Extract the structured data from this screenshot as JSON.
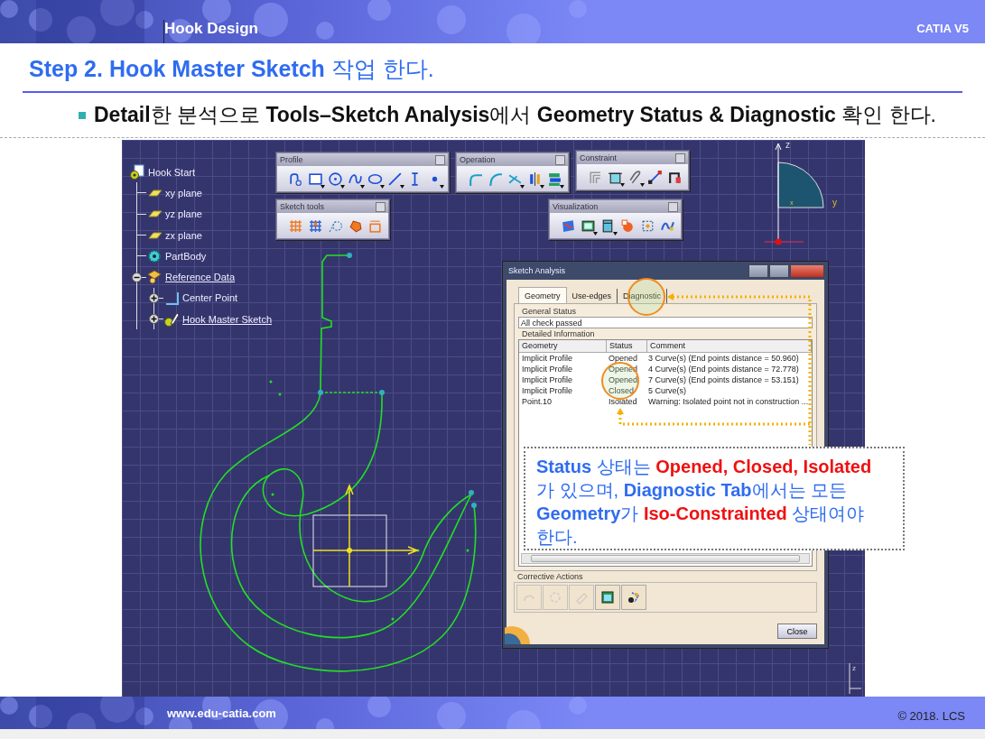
{
  "header": {
    "title": "Hook Design",
    "product": "CATIA V5"
  },
  "heading": "**Step 2. Hook Master Sketch** 작업 한다.",
  "bullet": "**Detail**한 분석으로 **Tools–Sketch Analysis**에서 **Geometry Status & Diagnostic** 확인 한다.",
  "tree": [
    {
      "label": "Hook Start",
      "kind": "part",
      "underlined": false,
      "children": [
        {
          "label": "xy plane",
          "kind": "plane",
          "underlined": false
        },
        {
          "label": "yz plane",
          "kind": "plane",
          "underlined": false
        },
        {
          "label": "zx plane",
          "kind": "plane",
          "underlined": false
        },
        {
          "label": "PartBody",
          "kind": "body",
          "underlined": false
        },
        {
          "label": "Reference Data",
          "kind": "geoset",
          "expanded": true,
          "underlined": true,
          "children": [
            {
              "label": "Center Point",
              "kind": "point",
              "expanded": false,
              "underlined": false
            },
            {
              "label": "Hook Master Sketch",
              "kind": "sketch",
              "expanded": false,
              "underlined": true
            }
          ]
        }
      ]
    }
  ],
  "toolbars": [
    {
      "title": "Profile",
      "tools": [
        {
          "kind": "profile",
          "dropdown": false
        },
        {
          "kind": "rectangle",
          "dropdown": true
        },
        {
          "kind": "circle",
          "dropdown": true
        },
        {
          "kind": "spline",
          "dropdown": true
        },
        {
          "kind": "ellipse",
          "dropdown": true
        },
        {
          "kind": "line",
          "dropdown": true
        },
        {
          "kind": "axis",
          "dropdown": false
        },
        {
          "kind": "point",
          "dropdown": true
        }
      ]
    },
    {
      "title": "Operation",
      "tools": [
        {
          "kind": "corner",
          "dropdown": false
        },
        {
          "kind": "chamfer",
          "dropdown": false
        },
        {
          "kind": "trim",
          "dropdown": true
        },
        {
          "kind": "mirror",
          "dropdown": true
        },
        {
          "kind": "project",
          "dropdown": true
        }
      ]
    },
    {
      "title": "Constraint",
      "tools": [
        {
          "kind": "bracket",
          "dropdown": false
        },
        {
          "kind": "box",
          "dropdown": true
        },
        {
          "kind": "clip",
          "dropdown": true
        },
        {
          "kind": "diagonal",
          "dropdown": false
        },
        {
          "kind": "animate",
          "dropdown": false
        }
      ]
    },
    {
      "title": "Sketch tools",
      "tools": [
        {
          "kind": "grid",
          "dropdown": false
        },
        {
          "kind": "snap",
          "dropdown": false
        },
        {
          "kind": "construction",
          "dropdown": false
        },
        {
          "kind": "hand",
          "dropdown": false
        },
        {
          "kind": "dimension",
          "dropdown": false
        }
      ]
    },
    {
      "title": "Visualization",
      "tools": [
        {
          "kind": "cut",
          "dropdown": false
        },
        {
          "kind": "frame",
          "dropdown": true
        },
        {
          "kind": "solid",
          "dropdown": true
        },
        {
          "kind": "sun",
          "dropdown": false
        },
        {
          "kind": "dots",
          "dropdown": false
        },
        {
          "kind": "wave",
          "dropdown": false
        }
      ]
    }
  ],
  "compass": {
    "labels": [
      "z",
      "y",
      "x"
    ]
  },
  "corner_axis": "z",
  "dialog": {
    "title": "Sketch Analysis",
    "tabs": [
      {
        "label": "Geometry",
        "selected": true
      },
      {
        "label": "Use-edges",
        "selected": false
      },
      {
        "label": "Diagnostic",
        "selected": false
      }
    ],
    "general_status": {
      "label": "General Status",
      "value": "All check passed"
    },
    "detailed": {
      "label": "Detailed Information",
      "columns": [
        "Geometry",
        "Status",
        "Comment"
      ],
      "rows": [
        [
          "Implicit Profile",
          "Opened",
          "3 Curve(s)  (End points distance = 50.960)"
        ],
        [
          "Implicit Profile",
          "Opened",
          "4 Curve(s)  (End points distance = 72.778)"
        ],
        [
          "Implicit Profile",
          "Opened",
          "7 Curve(s)  (End points distance = 53.151)"
        ],
        [
          "Implicit Profile",
          "Closed",
          "5 Curve(s)"
        ],
        [
          "Point.10",
          "Isolated",
          "Warning: Isolated point not in construction ..."
        ]
      ]
    },
    "corrective": {
      "label": "Corrective Actions",
      "actions": [
        {
          "kind": "shape",
          "disabled": true
        },
        {
          "kind": "rotate",
          "disabled": true
        },
        {
          "kind": "eraser",
          "disabled": true
        },
        {
          "kind": "table",
          "disabled": false
        },
        {
          "kind": "network",
          "disabled": false
        }
      ]
    },
    "close": "Close"
  },
  "callout": [
    {
      "text": "Status",
      "kind": "term"
    },
    {
      "text": " 상태는 ",
      "kind": "plain"
    },
    {
      "text": "Opened, Closed, Isolated",
      "kind": "highlight"
    },
    {
      "text": " 가 있으며, ",
      "kind": "plain"
    },
    {
      "text": "Diagnostic Tab",
      "kind": "term"
    },
    {
      "text": "에서는 모든 ",
      "kind": "plain"
    },
    {
      "text": "Geometry",
      "kind": "term"
    },
    {
      "text": "가 ",
      "kind": "plain"
    },
    {
      "text": "Iso-Constrainted",
      "kind": "highlight"
    },
    {
      "text": " 상태여야 한다.",
      "kind": "plain"
    }
  ],
  "footer": {
    "url": "www.edu-catia.com",
    "copyright": "© 2018. LCS"
  }
}
